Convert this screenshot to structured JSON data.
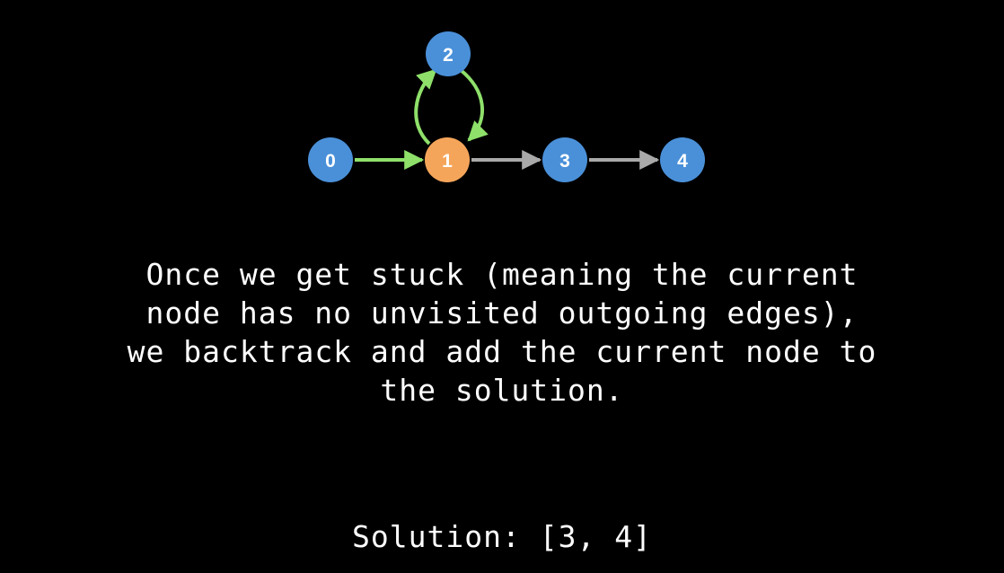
{
  "graph": {
    "colors": {
      "unvisited": "#4a90d9",
      "current": "#f5a55a",
      "traversed_edge": "#8ee06a",
      "untraversed_edge": "#a9a9a9",
      "background": "#000000"
    },
    "nodes": [
      {
        "id": "0",
        "label": "0",
        "state": "unvisited"
      },
      {
        "id": "1",
        "label": "1",
        "state": "current"
      },
      {
        "id": "2",
        "label": "2",
        "state": "unvisited"
      },
      {
        "id": "3",
        "label": "3",
        "state": "unvisited"
      },
      {
        "id": "4",
        "label": "4",
        "state": "unvisited"
      }
    ],
    "edges": [
      {
        "from": "0",
        "to": "1",
        "state": "traversed"
      },
      {
        "from": "1",
        "to": "2",
        "state": "traversed"
      },
      {
        "from": "2",
        "to": "1",
        "state": "traversed"
      },
      {
        "from": "1",
        "to": "3",
        "state": "untraversed"
      },
      {
        "from": "3",
        "to": "4",
        "state": "untraversed"
      }
    ]
  },
  "caption": {
    "lines": [
      "Once we get stuck (meaning the current",
      "node has no unvisited outgoing edges),",
      "we backtrack and add the current node to",
      "the solution."
    ]
  },
  "solution": {
    "text": "Solution: [3, 4]"
  }
}
